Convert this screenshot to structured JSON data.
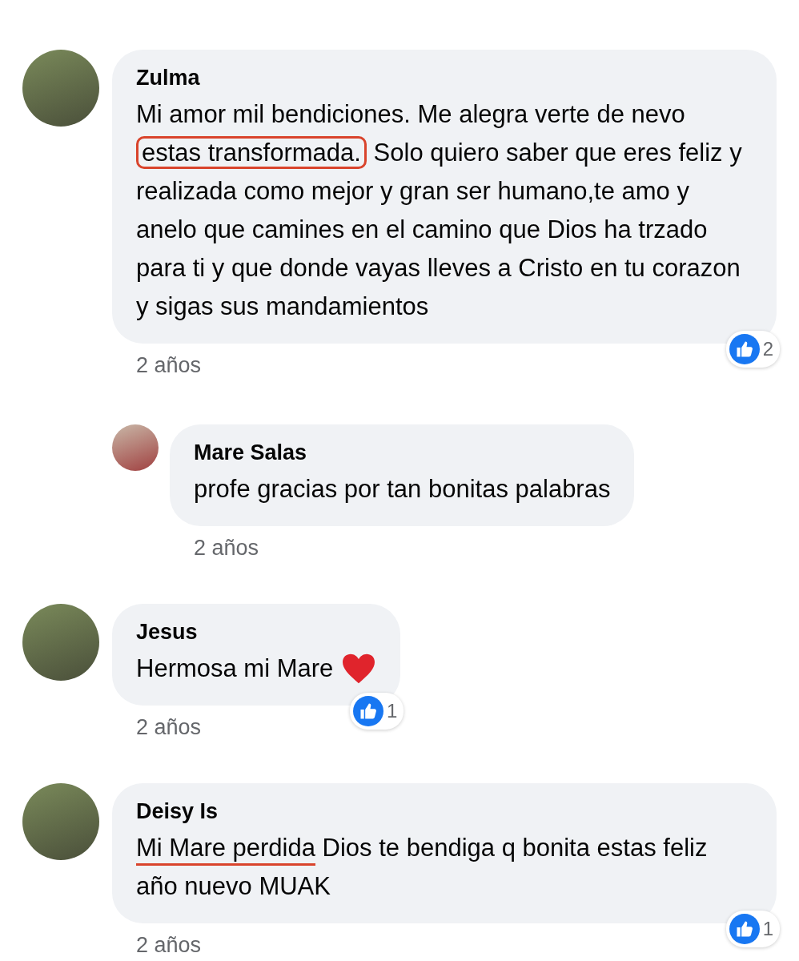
{
  "comments": [
    {
      "author": "Zulma",
      "reply": false,
      "heart": false,
      "parts": [
        {
          "text": "Mi amor mil bendiciones. Me alegra verte de nevo ",
          "circled": false,
          "underlined": false
        },
        {
          "text": "estas transformada.",
          "circled": true,
          "underlined": false
        },
        {
          "text": " Solo quiero saber que eres feliz y realizada como mejor y gran ser humano,te amo y anelo que camines en el camino que Dios ha trzado para ti y que donde vayas lleves a Cristo en tu corazon y sigas sus mandamientos",
          "circled": false,
          "underlined": false
        }
      ],
      "time": "2 años",
      "likes": "2"
    },
    {
      "author": "Mare Salas",
      "reply": true,
      "heart": false,
      "parts": [
        {
          "text": "profe gracias por tan bonitas palabras",
          "circled": false,
          "underlined": false
        }
      ],
      "time": "2 años"
    },
    {
      "author": "Jesus",
      "reply": false,
      "heart": true,
      "parts": [
        {
          "text": "Hermosa mi Mare",
          "circled": false,
          "underlined": false
        }
      ],
      "time": "2 años",
      "likes": "1"
    },
    {
      "author": "Deisy Is",
      "reply": false,
      "heart": false,
      "parts": [
        {
          "text": "Mi Mare perdida",
          "circled": false,
          "underlined": true
        },
        {
          "text": " Dios te bendiga q bonita estas feliz año nuevo MUAK",
          "circled": false,
          "underlined": false
        }
      ],
      "time": "2 años",
      "likes": "1"
    }
  ]
}
